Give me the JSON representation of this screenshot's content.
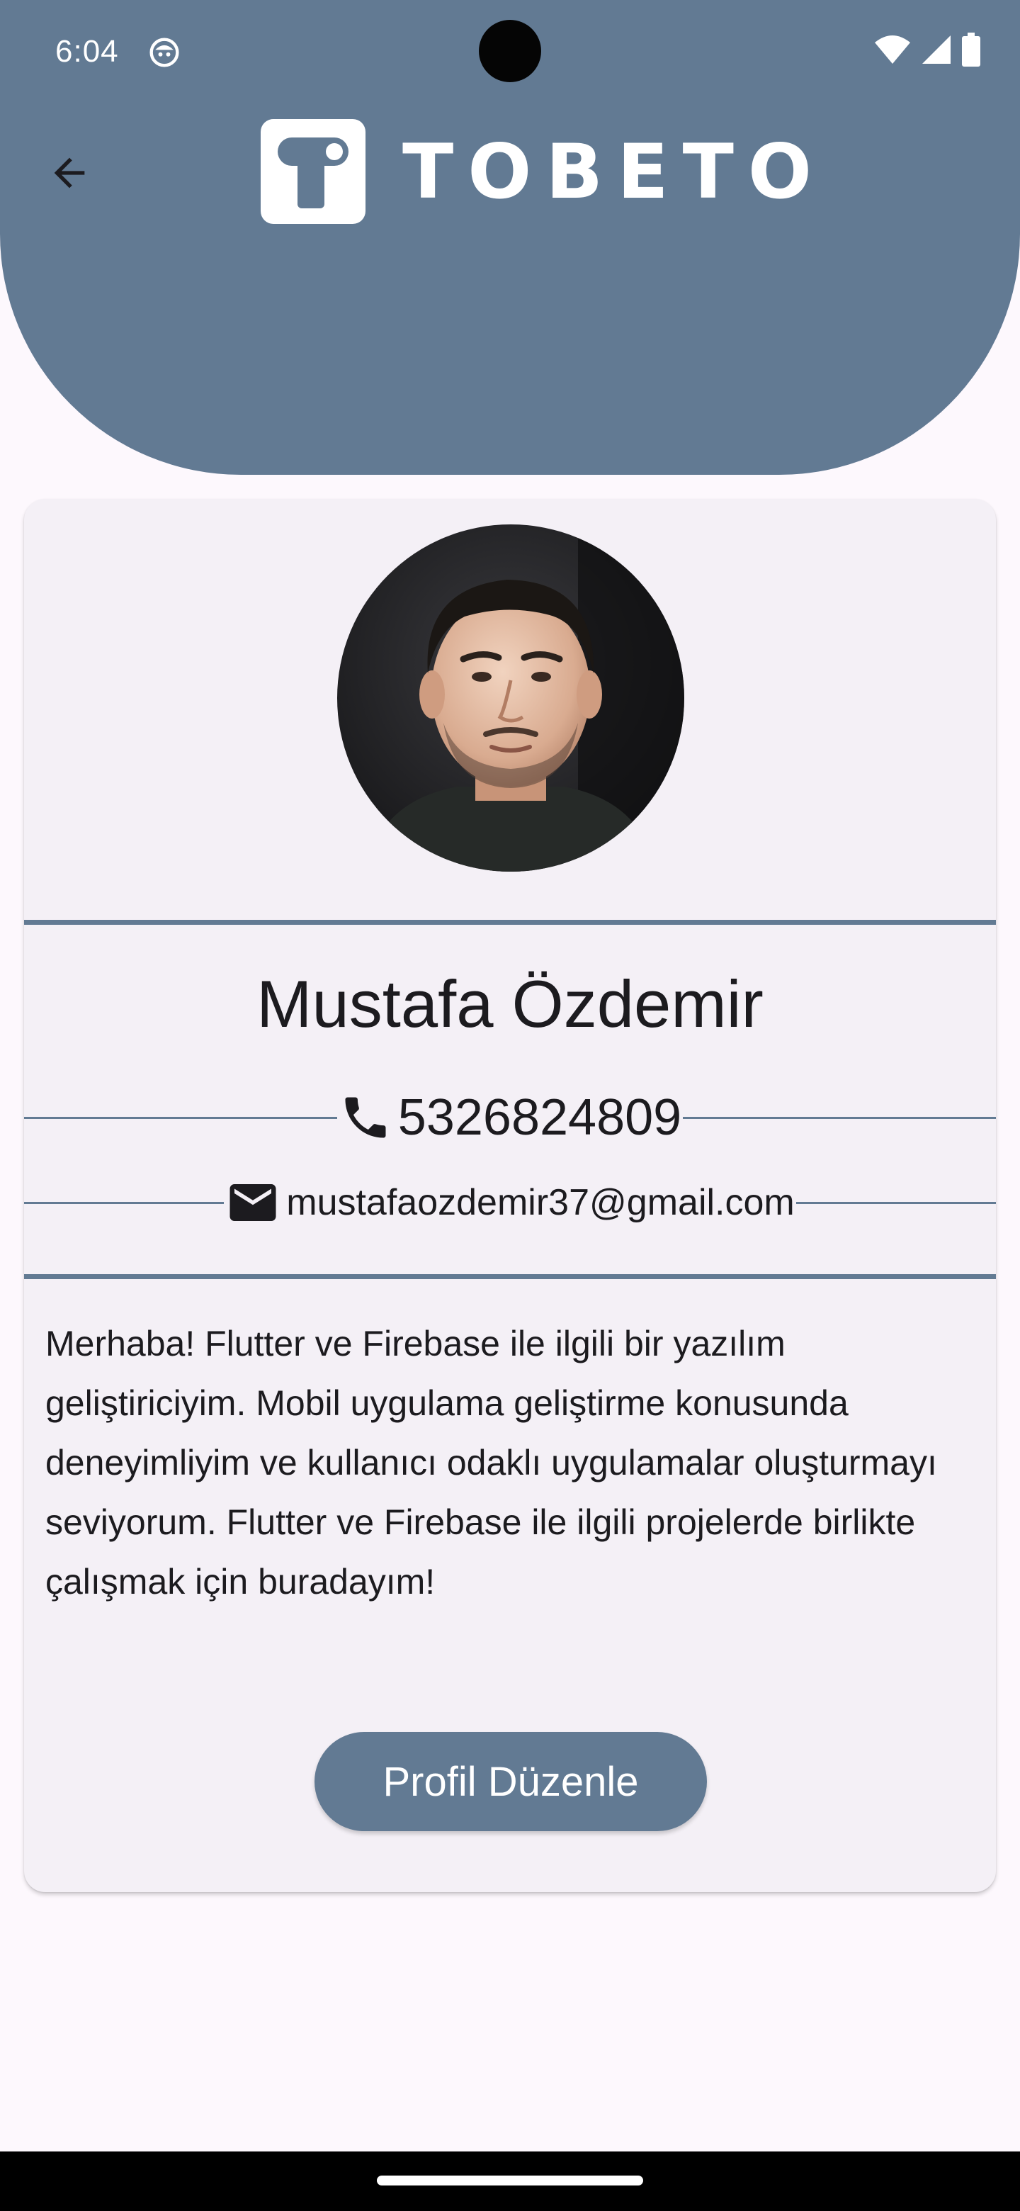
{
  "status_bar": {
    "time": "6:04"
  },
  "header": {
    "brand_name": "TOBETO",
    "back_icon": "arrow-back-icon"
  },
  "profile": {
    "name": "Mustafa Özdemir",
    "phone": "5326824809",
    "email": "mustafaozdemir37@gmail.com",
    "bio": "Merhaba! Flutter ve Firebase ile ilgili bir yazılım geliştiriciyim. Mobil uygulama geliştirme konusunda deneyimliyim ve kullanıcı odaklı uygulamalar oluşturmayı seviyorum. Flutter ve Firebase ile ilgili projelerde birlikte çalışmak için buradayım!",
    "edit_button_label": "Profil Düzenle"
  },
  "colors": {
    "primary": "#627a93",
    "background": "#fdf8fd",
    "card": "#f4f0f6",
    "text": "#1c1b1f"
  }
}
